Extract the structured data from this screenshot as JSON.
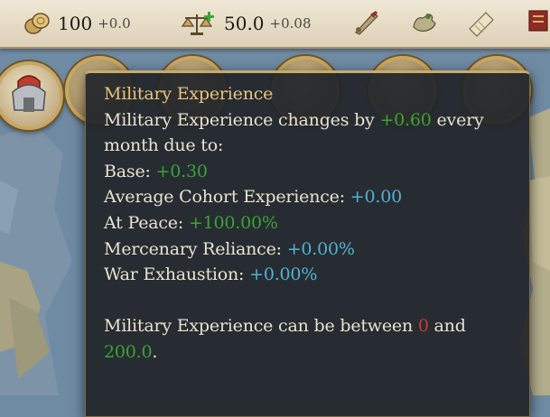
{
  "resources": {
    "wealth": {
      "value": "100",
      "delta": "+0.0",
      "icon": "gold-coins-icon"
    },
    "stability": {
      "value": "50.0",
      "delta": "+0.08",
      "icon": "scales-plus-icon"
    }
  },
  "toolbar_icons": [
    "quill-icon",
    "hand-icon",
    "scroll-icon",
    "war-banner-icon"
  ],
  "tooltip": {
    "title": "Military Experience",
    "intro_a": "Military Experience changes by ",
    "intro_value": "+0.60",
    "intro_b": " every",
    "intro_line2": "month due to:",
    "modifiers": [
      {
        "label": "Base: ",
        "value": "+0.30",
        "tone": "pos"
      },
      {
        "label": "Average Cohort Experience: ",
        "value": "+0.00",
        "tone": "neu"
      },
      {
        "label": "At Peace: ",
        "value": "+100.00%",
        "tone": "pos"
      },
      {
        "label": "Mercenary Reliance: ",
        "value": "+0.00%",
        "tone": "neu"
      },
      {
        "label": "War Exhaustion: ",
        "value": "+0.00%",
        "tone": "neu"
      }
    ],
    "range_a": "Military Experience can be between ",
    "range_min": "0",
    "range_b": " and",
    "range_max": "200.0",
    "range_end": "."
  },
  "colors": {
    "positive": "#3aa432",
    "neutral": "#4fb3d3",
    "negative": "#cf3a2e",
    "title": "#e7c47c",
    "text": "#eae2d0"
  }
}
